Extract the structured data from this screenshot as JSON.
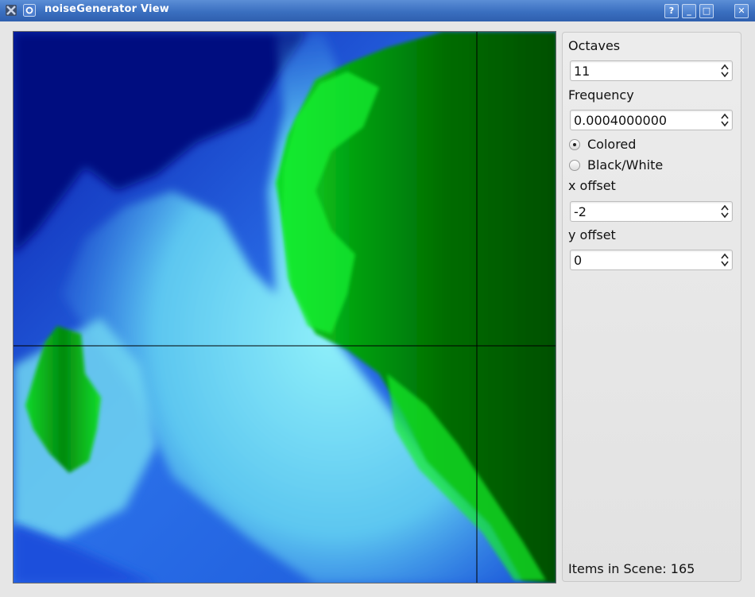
{
  "window": {
    "title": "noiseGenerator View",
    "title_buttons": {
      "help": "?",
      "minimize": "_",
      "maximize": "□",
      "close": "✕"
    }
  },
  "panel": {
    "octaves_label": "Octaves",
    "octaves_value": "11",
    "frequency_label": "Frequency",
    "frequency_value": "0.0004000000",
    "color_mode": {
      "colored_label": "Colored",
      "bw_label": "Black/White",
      "selected": "Colored"
    },
    "x_offset_label": "x offset",
    "x_offset_value": "-2",
    "y_offset_label": "y offset",
    "y_offset_value": "0",
    "items_in_scene": "Items in Scene: 165"
  },
  "colors": {
    "deep_water": "#000c80",
    "water": "#1e4fe0",
    "shallow": "#7fe8f6",
    "land_bright": "#00ff18",
    "land_dark": "#005a00",
    "title_bar": "#3a6fc0"
  }
}
